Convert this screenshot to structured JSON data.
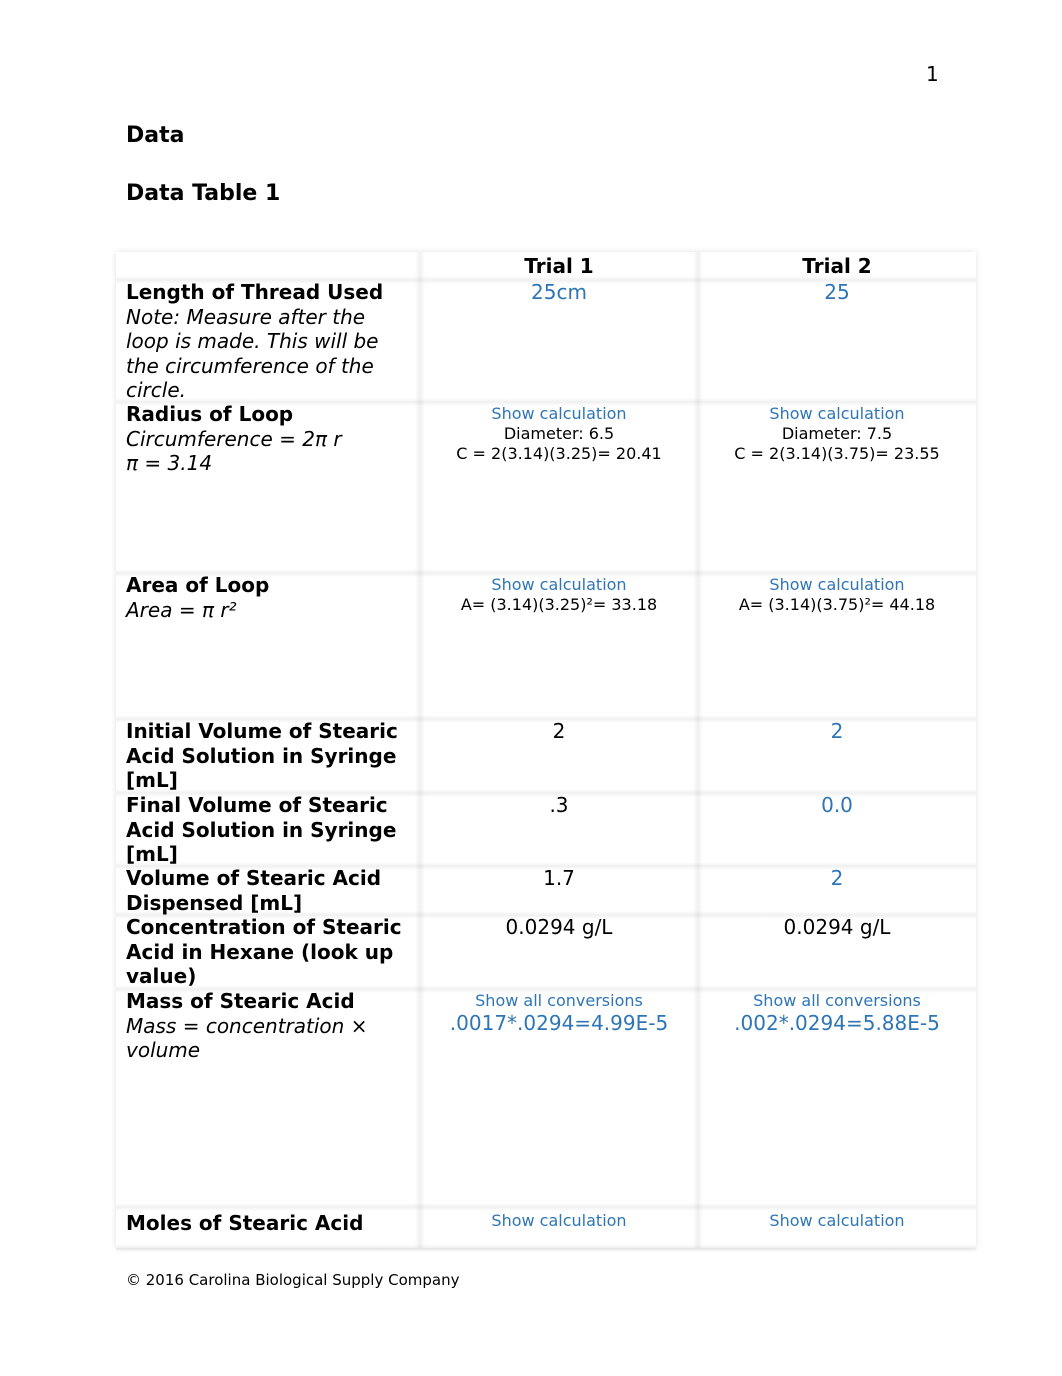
{
  "page_number": "1",
  "heading": "Data",
  "table_title": "Data Table 1",
  "table": {
    "headers": [
      "",
      "Trial 1",
      "Trial 2"
    ],
    "rows": [
      {
        "label": "Length of Thread Used",
        "note": "Note: Measure after the loop is made. This will be the circumference of the circle.",
        "trial1": {
          "value": "25cm"
        },
        "trial2": {
          "value": "25"
        }
      },
      {
        "label": "Radius of Loop",
        "note": "Circumference = 2π r",
        "note2": "π = 3.14",
        "trial1": {
          "link": "Show calculation",
          "line1": "Diameter: 6.5",
          "line2": "C = 2(3.14)(3.25)= 20.41"
        },
        "trial2": {
          "link": "Show calculation",
          "line1": "Diameter: 7.5",
          "line2": "C = 2(3.14)(3.75)= 23.55"
        }
      },
      {
        "label": "Area of Loop",
        "note": "Area = π r²",
        "trial1": {
          "link": "Show calculation",
          "line1": "A= (3.14)(3.25)²= 33.18"
        },
        "trial2": {
          "link": "Show calculation",
          "line1": "A= (3.14)(3.75)²= 44.18"
        }
      },
      {
        "label": "Initial Volume of Stearic Acid Solution in Syringe [mL]",
        "trial1": {
          "value": "2"
        },
        "trial2": {
          "value": "2"
        }
      },
      {
        "label": "Final Volume of Stearic Acid Solution in Syringe [mL]",
        "trial1": {
          "value": ".3"
        },
        "trial2": {
          "value": "0.0"
        }
      },
      {
        "label": "Volume of Stearic Acid Dispensed [mL]",
        "trial1": {
          "value": "1.7"
        },
        "trial2": {
          "value": "2"
        }
      },
      {
        "label": "Concentration of Stearic Acid in Hexane (look up value)",
        "trial1": {
          "value": "0.0294 g/L"
        },
        "trial2": {
          "value": "0.0294 g/L"
        }
      },
      {
        "label": "Mass of Stearic Acid",
        "note": "Mass = concentration × volume",
        "trial1": {
          "link": "Show all conversions",
          "value": ".0017*.0294=4.99E-5"
        },
        "trial2": {
          "link": "Show all conversions",
          "value": ".002*.0294=5.88E-5"
        }
      },
      {
        "label": "Moles of Stearic Acid",
        "trial1": {
          "link": "Show calculation"
        },
        "trial2": {
          "link": "Show calculation"
        }
      }
    ]
  },
  "footer": "© 2016 Carolina Biological Supply Company",
  "colors": {
    "answer_blue": "#2e75b6",
    "text": "#000000"
  }
}
